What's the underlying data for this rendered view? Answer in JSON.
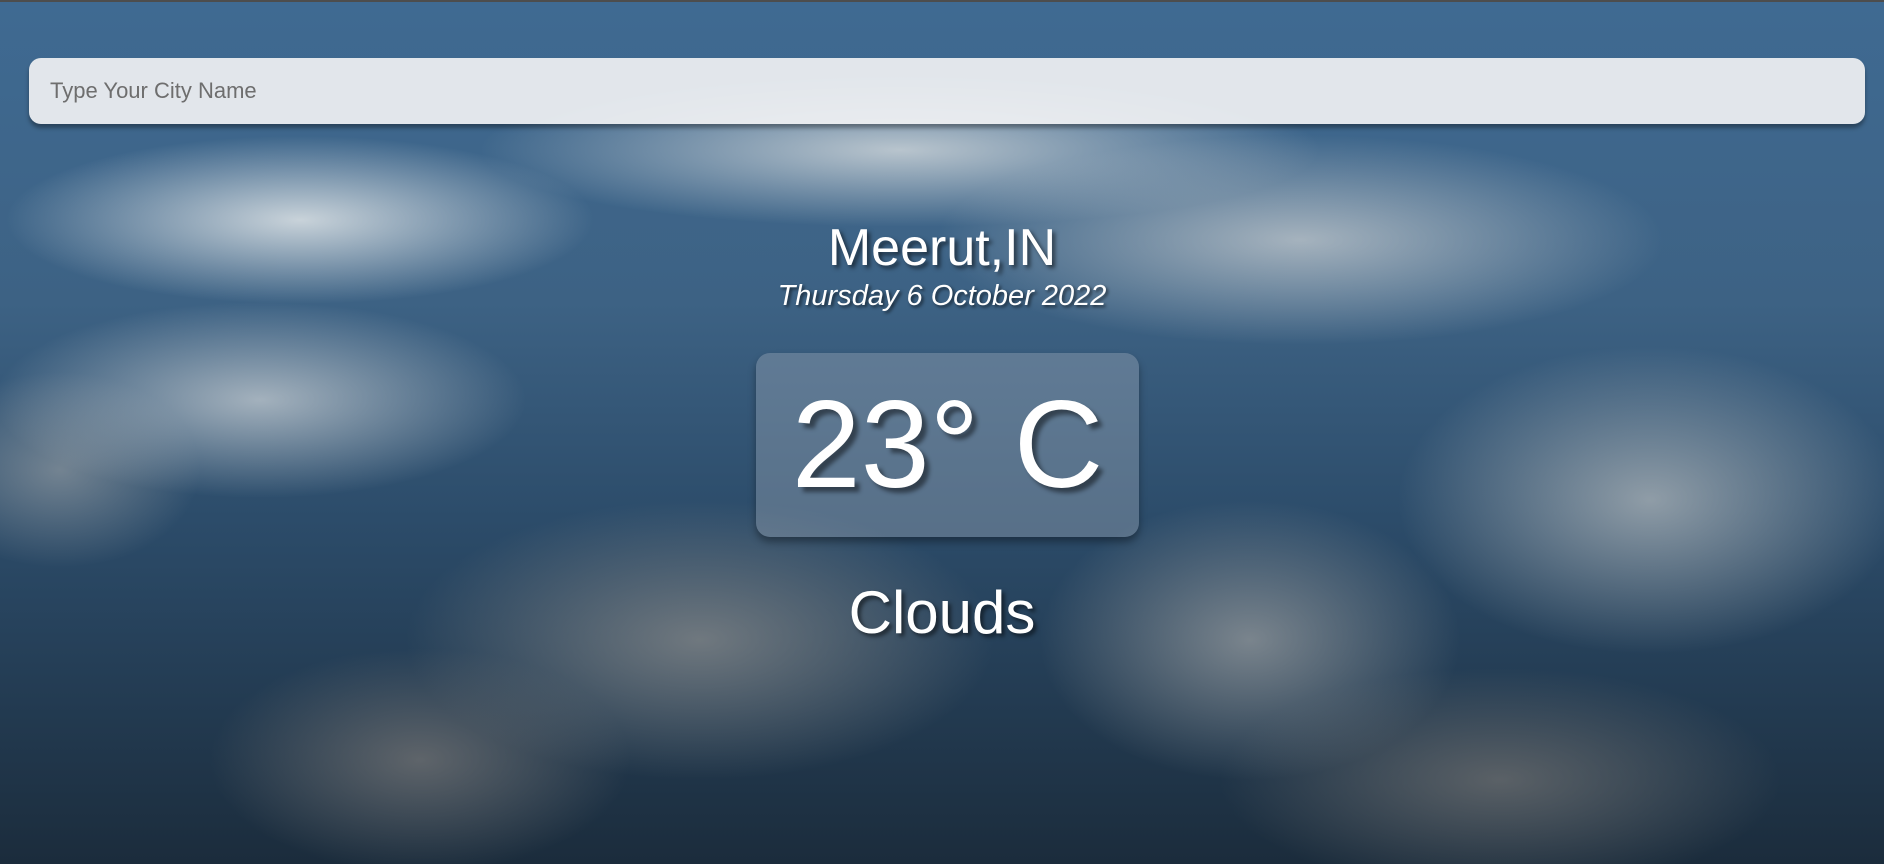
{
  "search": {
    "placeholder": "Type Your City Name",
    "value": ""
  },
  "weather": {
    "location": "Meerut,IN",
    "date": "Thursday 6 October 2022",
    "temperature": "23° C",
    "condition": "Clouds"
  },
  "theme": {
    "background": "cloudy-sky",
    "text_color": "#ffffff"
  }
}
